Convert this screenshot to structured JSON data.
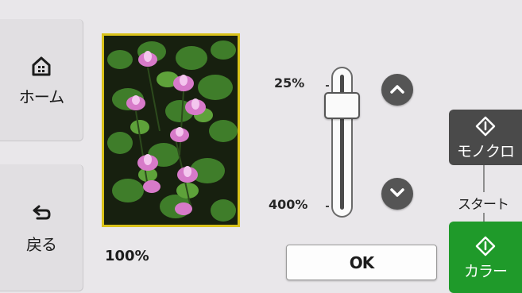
{
  "left_nav": {
    "home_label": "ホーム",
    "back_label": "戻る"
  },
  "preview": {
    "zoom_value": "100%",
    "frame_color": "#d9c21a"
  },
  "zoom_slider": {
    "min_label": "25%",
    "max_label": "400%",
    "level_percent": 100
  },
  "buttons": {
    "ok_label": "OK",
    "start_label": "スタート",
    "mono_label": "モノクロ",
    "color_label": "カラー"
  },
  "colors": {
    "background": "#e9e7ea",
    "mono_button": "#4a4a4a",
    "color_button": "#1f9a2a",
    "round_button": "#555555"
  },
  "icons": {
    "home": "home-icon",
    "back": "back-arrow-icon",
    "zoom_up": "chevron-up-icon",
    "zoom_down": "chevron-down-icon",
    "start_mono": "start-diamond-icon",
    "start_color": "start-diamond-icon"
  }
}
